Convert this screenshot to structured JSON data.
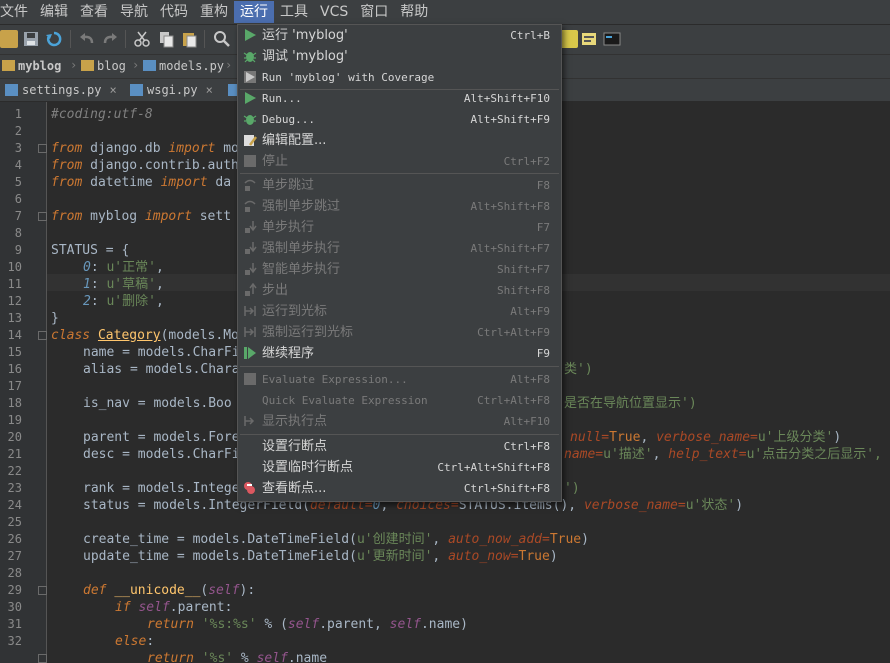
{
  "menubar": [
    "文件",
    "编辑",
    "查看",
    "导航",
    "代码",
    "重构",
    "运行",
    "工具",
    "VCS",
    "窗口",
    "帮助"
  ],
  "breadcrumb": [
    "myblog",
    "blog",
    "models.py"
  ],
  "tabs": [
    {
      "label": "settings.py",
      "close": "×"
    },
    {
      "label": "wsgi.py",
      "close": "×"
    }
  ],
  "line_numbers": [
    "1",
    "2",
    "3",
    "4",
    "5",
    "6",
    "7",
    "8",
    "9",
    "10",
    "11",
    "12",
    "13",
    "14",
    "15",
    "16",
    "17",
    "18",
    "19",
    "20",
    "21",
    "22",
    "23",
    "24",
    "25",
    "26",
    "27",
    "28",
    "29",
    "30",
    "31",
    "32"
  ],
  "code": {
    "l1": "#coding:utf-8",
    "l3a": "from",
    "l3b": " django.db ",
    "l3c": "import",
    "l3d": " mo",
    "l4a": "from",
    "l4b": " django.contrib.auth",
    "l5a": "from",
    "l5b": " datetime ",
    "l5c": "import",
    "l5d": " da",
    "l7a": "from",
    "l7b": " myblog ",
    "l7c": "import",
    "l7d": " sett",
    "l9": "STATUS = {",
    "l10a": "0",
    "l10b": ": ",
    "l10c": "u'正常'",
    "l10d": ",",
    "l11a": "1",
    "l11b": ": ",
    "l11c": "u'草稿'",
    "l11d": ",",
    "l12a": "2",
    "l12b": ": ",
    "l12c": "u'删除'",
    "l12d": ",",
    "l13": "}",
    "l14a": "class",
    "l14b": "Category",
    "l14c": "(models.Mo",
    "l15": "name = models.CharFi",
    "l16": "alias = models.Chara",
    "l16r": "类')",
    "l18": "is_nav = models.Boo",
    "l18r": "是否在导航位置显示')",
    "l20": "parent = models.Fore",
    "l20r1": "null=",
    "l20r2": "True",
    "l20r3": ", ",
    "l20r4": "verbose_name=",
    "l20r5": "u'上级分类'",
    "l20r6": ")",
    "l21": "desc = models.CharFi",
    "l21r1": "name=",
    "l21r2": "u'描述'",
    "l21r3": ", ",
    "l21r4": "help_text=",
    "l21r5": "u'点击分类之后显示',",
    "l23": "rank = models.Intege",
    "l23r": "')",
    "l24a": "status = models.IntegerField(",
    "l24b": "default=",
    "l24c": "0",
    "l24d": ", ",
    "l24e": "choices=",
    "l24f": "STATUS.items(), ",
    "l24g": "verbose_name=",
    "l24h": "u'状态'",
    "l24i": ")",
    "l26a": "create_time = models.DateTimeField(",
    "l26b": "u'创建时间'",
    "l26c": ", ",
    "l26d": "auto_now_add=",
    "l26e": "True",
    "l26f": ")",
    "l27a": "update_time = models.DateTimeField(",
    "l27b": "u'更新时间'",
    "l27c": ", ",
    "l27d": "auto_now=",
    "l27e": "True",
    "l27f": ")",
    "l29a": "def",
    "l29b": "__unicode__",
    "l29c": "(",
    "l29d": "self",
    "l29e": "):",
    "l30a": "if",
    "l30b": "self",
    "l30c": ".parent:",
    "l31a": "return",
    "l31b": "'%s:%s'",
    "l31c": " % (",
    "l31d": "self",
    "l31e": ".parent, ",
    "l31f": "self",
    "l31g": ".name)",
    "l32a": "else",
    "l32b": ":",
    "l33a": "return",
    "l33b": "'%s'",
    "l33c": " % ",
    "l33d": "self",
    "l33e": ".name"
  },
  "run_menu": [
    {
      "label": "运行 'myblog'",
      "shortcut": "Ctrl+B",
      "disabled": false
    },
    {
      "label": "调试 'myblog'",
      "shortcut": "",
      "disabled": false
    },
    {
      "label": "Run 'myblog' with Coverage",
      "shortcut": "",
      "disabled": false
    },
    {
      "label": "Run...",
      "shortcut": "Alt+Shift+F10",
      "disabled": false
    },
    {
      "label": "Debug...",
      "shortcut": "Alt+Shift+F9",
      "disabled": false
    },
    {
      "label": "编辑配置...",
      "shortcut": "",
      "disabled": false
    },
    {
      "label": "停止",
      "shortcut": "Ctrl+F2",
      "disabled": true
    },
    {
      "label": "单步跳过",
      "shortcut": "F8",
      "disabled": true
    },
    {
      "label": "强制单步跳过",
      "shortcut": "Alt+Shift+F8",
      "disabled": true
    },
    {
      "label": "单步执行",
      "shortcut": "F7",
      "disabled": true
    },
    {
      "label": "强制单步执行",
      "shortcut": "Alt+Shift+F7",
      "disabled": true
    },
    {
      "label": "智能单步执行",
      "shortcut": "Shift+F7",
      "disabled": true
    },
    {
      "label": "步出",
      "shortcut": "Shift+F8",
      "disabled": true
    },
    {
      "label": "运行到光标",
      "shortcut": "Alt+F9",
      "disabled": true
    },
    {
      "label": "强制运行到光标",
      "shortcut": "Ctrl+Alt+F9",
      "disabled": true
    },
    {
      "label": "继续程序",
      "shortcut": "F9",
      "disabled": false
    },
    {
      "label": "Evaluate Expression...",
      "shortcut": "Alt+F8",
      "disabled": true
    },
    {
      "label": "Quick Evaluate Expression",
      "shortcut": "Ctrl+Alt+F8",
      "disabled": true
    },
    {
      "label": "显示执行点",
      "shortcut": "Alt+F10",
      "disabled": true
    },
    {
      "label": "设置行断点",
      "shortcut": "Ctrl+F8",
      "disabled": false
    },
    {
      "label": "设置临时行断点",
      "shortcut": "Ctrl+Alt+Shift+F8",
      "disabled": false
    },
    {
      "label": "查看断点...",
      "shortcut": "Ctrl+Shift+F8",
      "disabled": false
    }
  ]
}
